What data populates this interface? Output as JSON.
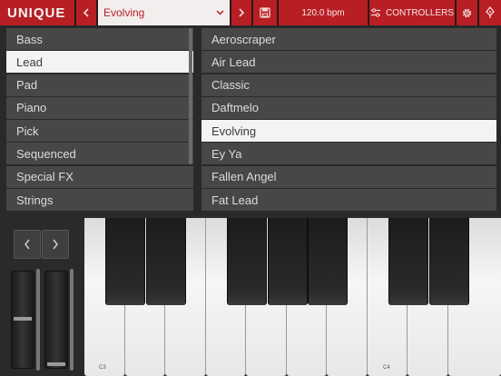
{
  "header": {
    "logo": "UNIQUE",
    "preset": "Evolving",
    "tempo": "120.0 bpm",
    "controllers_label": "CONTROLLERS"
  },
  "icons": {
    "prev": "chevron-left-icon",
    "next": "chevron-right-icon",
    "dropdown": "chevron-down-icon",
    "save": "floppy-disk-icon",
    "controllers": "sliders-icon",
    "settings": "gear-icon",
    "tuner": "tuning-fork-icon"
  },
  "categories": [
    {
      "label": "Bass"
    },
    {
      "label": "Lead"
    },
    {
      "label": "Pad"
    },
    {
      "label": "Piano"
    },
    {
      "label": "Pick"
    },
    {
      "label": "Sequenced"
    },
    {
      "label": "Special FX"
    },
    {
      "label": "Strings"
    }
  ],
  "selected_category": "Lead",
  "presets": [
    {
      "label": "Aeroscraper"
    },
    {
      "label": "Air Lead"
    },
    {
      "label": "Classic"
    },
    {
      "label": "Daftmelo"
    },
    {
      "label": "Evolving"
    },
    {
      "label": "Ey Ya"
    },
    {
      "label": "Fallen Angel"
    },
    {
      "label": "Fat Lead"
    }
  ],
  "selected_preset": "Evolving",
  "keyboard": {
    "labels": {
      "c3": "C3",
      "c4": "C4"
    }
  },
  "colors": {
    "accent": "#b71f24",
    "selected_row": "#f3f3f3",
    "row": "#474747"
  }
}
